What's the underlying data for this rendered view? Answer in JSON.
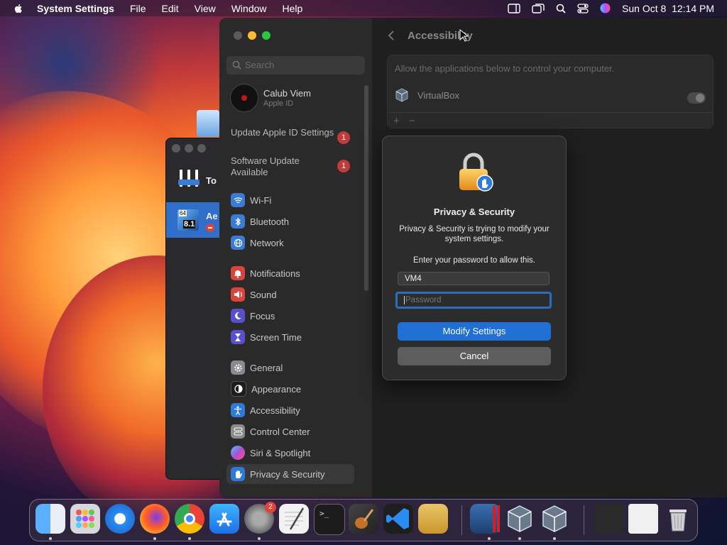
{
  "menubar": {
    "app_name": "System Settings",
    "items": [
      "File",
      "Edit",
      "View",
      "Window",
      "Help"
    ],
    "datetime": "Sun Oct 8  12:14 PM"
  },
  "back_window": {
    "row1_label": "To",
    "row2_label": "Ae",
    "row2_icon_text": "8.1",
    "row2_icon_small": "64"
  },
  "sidebar": {
    "search_placeholder": "Search",
    "profile": {
      "name": "Calub Viem",
      "subtitle": "Apple ID"
    },
    "notices": [
      {
        "label": "Update Apple ID Settings",
        "badge": "1"
      },
      {
        "label": "Software Update Available",
        "badge": "1"
      }
    ],
    "items": [
      {
        "label": "Wi-Fi",
        "icon": "wifi-icon",
        "color": "#3a7bd5"
      },
      {
        "label": "Bluetooth",
        "icon": "bluetooth-icon",
        "color": "#3a7bd5"
      },
      {
        "label": "Network",
        "icon": "globe-icon",
        "color": "#3a7bd5"
      },
      {
        "label": "Notifications",
        "icon": "bell-icon",
        "color": "#d9453d"
      },
      {
        "label": "Sound",
        "icon": "speaker-icon",
        "color": "#d9453d"
      },
      {
        "label": "Focus",
        "icon": "moon-icon",
        "color": "#5a4fcf"
      },
      {
        "label": "Screen Time",
        "icon": "hourglass-icon",
        "color": "#5a4fcf"
      },
      {
        "label": "General",
        "icon": "gear-icon",
        "color": "#8a8a8e"
      },
      {
        "label": "Appearance",
        "icon": "appearance-icon",
        "color": "#1c1c1e"
      },
      {
        "label": "Accessibility",
        "icon": "accessibility-icon",
        "color": "#2f7ad9"
      },
      {
        "label": "Control Center",
        "icon": "control-center-icon",
        "color": "#8a8a8e"
      },
      {
        "label": "Siri & Spotlight",
        "icon": "siri-icon",
        "color": "#b04fcf"
      },
      {
        "label": "Privacy & Security",
        "icon": "hand-icon",
        "color": "#2f7ad9"
      }
    ]
  },
  "content": {
    "title": "Accessibility",
    "description": "Allow the applications below to control your computer.",
    "app_row": {
      "label": "VirtualBox"
    },
    "add_label": "+",
    "remove_label": "−"
  },
  "dialog": {
    "title": "Privacy & Security",
    "message": "Privacy & Security is trying to modify your system settings.",
    "prompt": "Enter your password to allow this.",
    "username_value": "VM4",
    "password_placeholder": "Password",
    "primary_button": "Modify Settings",
    "secondary_button": "Cancel"
  },
  "dock": {
    "settings_badge": "2"
  },
  "colors": {
    "accent": "#1f6fd4",
    "badge": "#c23a3a",
    "focus_ring": "#2a6fbf"
  }
}
